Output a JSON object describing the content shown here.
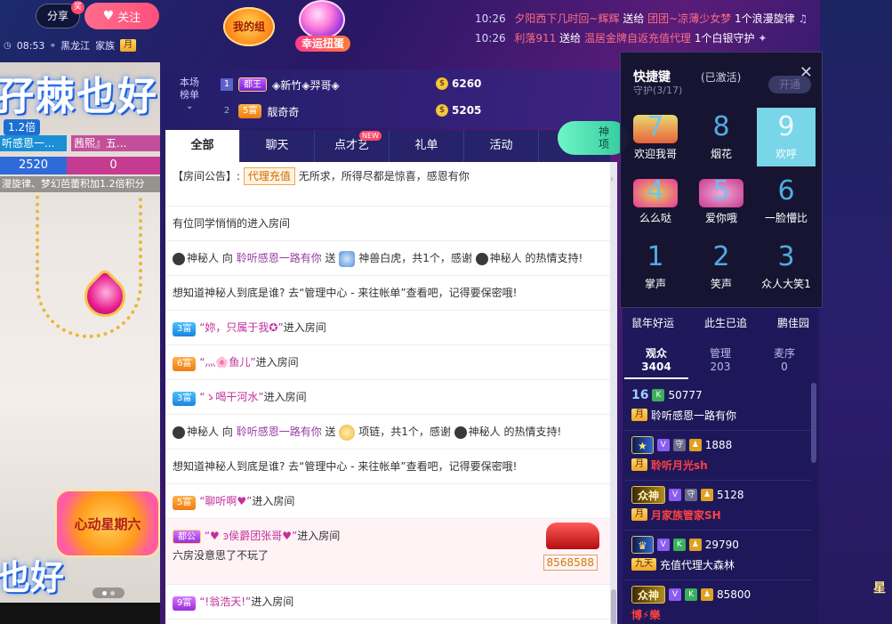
{
  "header": {
    "share_label": "分享",
    "share_badge": "奖",
    "follow_label": "关注",
    "time": "08:53",
    "location": "黑龙江",
    "family_label": "家族",
    "family_badge": "月",
    "my_group_label": "我的组",
    "lucky_egg_label": "幸运扭蛋"
  },
  "marquee": [
    {
      "time": "10:26",
      "user": "夕阳西下几时回~辉辉",
      "action": "送给",
      "target": "团团~凉薄少女梦",
      "item": "1个浪漫旋律"
    },
    {
      "time": "10:26",
      "user": "利落911",
      "action": "送给",
      "target": "温居金牌自返充值代理",
      "item": "1个白银守护"
    }
  ],
  "video": {
    "title_text": "孖棘也好",
    "multiplier": "1.2倍",
    "pk_left_name": "听感恩一...",
    "pk_right_name": "茜熙』五...",
    "pk_top_left": "4.1",
    "pk_top_right": "2倍",
    "score_left": "2520",
    "score_right": "0",
    "ticker": "漫旋律、梦幻芭蕾积加1.2倍积分",
    "promo_text": "心动星期六",
    "bottom_text": "也好"
  },
  "rank": {
    "label": "本场榜单",
    "rows": [
      {
        "no": "1",
        "level": "都王",
        "name": "◈新竹◈羿哥◈",
        "value": "6260"
      },
      {
        "no": "2",
        "level": "5富",
        "name": "靓奇奇",
        "value": "5205"
      }
    ]
  },
  "chat": {
    "tabs": [
      {
        "label": "全部",
        "active": true
      },
      {
        "label": "聊天",
        "active": false
      },
      {
        "label": "点才艺",
        "active": false,
        "badge": "NEW"
      },
      {
        "label": "礼单",
        "active": false
      },
      {
        "label": "活动",
        "active": false
      }
    ],
    "notice_prefix": "【房间公告】:",
    "notice_tag": "代理充值",
    "notice_text": "无所求，所得尽都是惊喜，感恩有你",
    "m1": "有位同学悄悄的进入房间",
    "m2_user": "神秘人",
    "m2_to": "向",
    "m2_target": "聆听感恩一路有你",
    "m2_send": "送",
    "m2_gift": "神兽白虎，共1个，感谢",
    "m2_thanks_user": "神秘人",
    "m2_tail": "的热情支持!",
    "m3": "想知道神秘人到底是谁? 去“管理中心 - 来往帐单”查看吧，记得要保密哦!",
    "m4_level": "3富",
    "m4_name": "“妳，只属于我✪”",
    "m4_tail": "进入房间",
    "m5_level": "6富",
    "m5_name": "“灬🌸鱼儿”",
    "m5_tail": "进入房间",
    "m6_level": "3富",
    "m6_name": "“ゝ喝干河水”",
    "m6_tail": "进入房间",
    "m7_user": "神秘人",
    "m7_to": "向",
    "m7_target": "聆听感恩一路有你",
    "m7_send": "送",
    "m7_gift": "项链，共1个，感谢",
    "m7_thanks_user": "神秘人",
    "m7_tail": "的热情支持!",
    "m8": "想知道神秘人到底是谁? 去“管理中心 - 来往帐单”查看吧，记得要保密哦!",
    "m9_level": "5富",
    "m9_name": "“聊听啊♥”",
    "m9_tail": "进入房间",
    "m10_level": "都公",
    "m10_name": "“♥ ͽ侯爵团张哥♥”",
    "m10_tail": "进入房间",
    "m10_line2": "六房没意思了不玩了",
    "m10_car_num": "8568588",
    "m11_level": "9富",
    "m11_name": "“!翁浩天!”",
    "m11_tail": "进入房间"
  },
  "god_btn": {
    "line1": "神",
    "line2": "项"
  },
  "shortcut": {
    "title": "快捷键",
    "status": "(已激活)",
    "guard_label": "守护(3/17)",
    "open_label": "开通",
    "keys": [
      {
        "num": "7",
        "label": "欢迎我哥"
      },
      {
        "num": "8",
        "label": "烟花"
      },
      {
        "num": "9",
        "label": "欢呼"
      },
      {
        "num": "4",
        "label": "么么哒"
      },
      {
        "num": "5",
        "label": "爱你哦"
      },
      {
        "num": "6",
        "label": "一脸懵比"
      },
      {
        "num": "1",
        "label": "掌声"
      },
      {
        "num": "2",
        "label": "笑声"
      },
      {
        "num": "3",
        "label": "众人大笑1"
      }
    ],
    "below": [
      "鼠年好运",
      "此生已追",
      "鹏佳园"
    ]
  },
  "audience": {
    "tabs": [
      {
        "label": "观众",
        "count": "3404",
        "active": true
      },
      {
        "label": "管理",
        "count": "203",
        "active": false
      },
      {
        "label": "麦序",
        "count": "0",
        "active": false
      }
    ],
    "items": [
      {
        "level": "16",
        "wealth": "",
        "id": "50777",
        "badge": "月",
        "name": "聆听感恩一路有你",
        "name_style": "",
        "extra": "vip"
      },
      {
        "level": "",
        "wealth": "",
        "id": "1888",
        "badge": "月",
        "name": "聆听月光sh",
        "name_style": "red",
        "extra": ""
      },
      {
        "level": "",
        "wealth": "众神",
        "id": "5128",
        "badge": "月",
        "name": "月家族管家SH",
        "name_style": "red",
        "extra": ""
      },
      {
        "level": "",
        "wealth": "",
        "id": "29790",
        "badge": "九天",
        "name": "充值代理大森林",
        "name_style": "",
        "extra": ""
      },
      {
        "level": "",
        "wealth": "众神",
        "id": "85800",
        "badge": "",
        "name": "博⚡樂",
        "name_style": "red",
        "extra": ""
      }
    ]
  },
  "side": {
    "star_label": "星"
  }
}
